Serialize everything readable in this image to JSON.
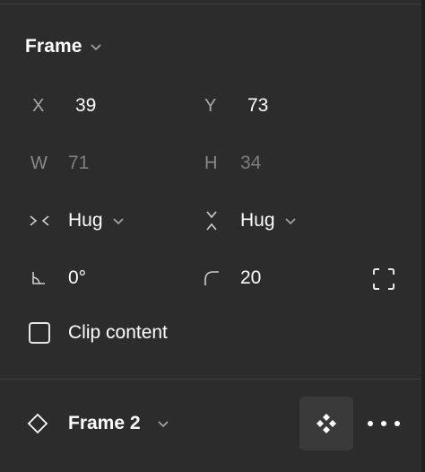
{
  "panel": {
    "section_title": "Frame",
    "fields": {
      "x": {
        "label": "X",
        "value": "39"
      },
      "y": {
        "label": "Y",
        "value": "73"
      },
      "w": {
        "label": "W",
        "value": "71"
      },
      "h": {
        "label": "H",
        "value": "34"
      },
      "horizontal_resizing": {
        "icon": "hug-horizontal-icon",
        "value": "Hug"
      },
      "vertical_resizing": {
        "icon": "hug-vertical-icon",
        "value": "Hug"
      },
      "rotation": {
        "icon": "rotation-angle-icon",
        "value": "0°"
      },
      "corner_radius": {
        "icon": "corner-radius-icon",
        "value": "20"
      }
    },
    "clip_content": {
      "label": "Clip content",
      "checked": false
    }
  },
  "layer": {
    "name": "Frame 2",
    "icon": "component-diamond-icon"
  },
  "colors": {
    "background": "#2c2c2c",
    "text": "#ffffff",
    "label_muted": "#a8a8a8",
    "disabled_value": "#7e7e7e",
    "button_bg": "#3a3a3a"
  }
}
